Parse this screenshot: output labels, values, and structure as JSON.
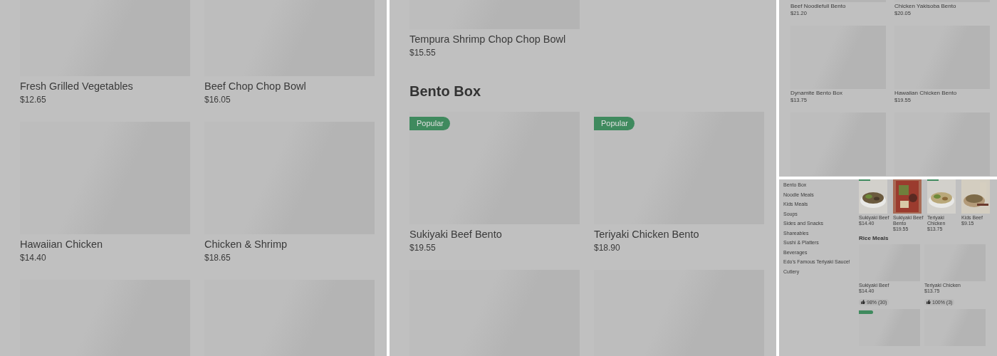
{
  "panels": [
    {
      "kind": "large",
      "sections": [
        {
          "cards": [
            {
              "kind": "item",
              "name": "Fresh Grilled Vegetables",
              "price": "$12.65"
            },
            {
              "kind": "item",
              "name": "Beef Chop Chop Bowl",
              "price": "$16.05"
            },
            {
              "kind": "item",
              "name": "Hawaiian Chicken",
              "price": "$14.40"
            },
            {
              "kind": "item",
              "name": "Chicken & Shrimp",
              "price": "$18.65"
            },
            {
              "kind": "image_only"
            },
            {
              "kind": "image_only"
            }
          ]
        }
      ]
    },
    {
      "kind": "large",
      "sections": [
        {
          "cards": [
            {
              "kind": "item",
              "name": "Tempura Shrimp Chop Chop Bowl",
              "price": "$15.55"
            }
          ]
        },
        {
          "title": "Bento Box",
          "cards": [
            {
              "kind": "item",
              "name": "Sukiyaki Beef Bento",
              "price": "$19.55",
              "badge": "Popular"
            },
            {
              "kind": "item",
              "name": "Teriyaki Chicken Bento",
              "price": "$18.90",
              "badge": "Popular"
            },
            {
              "kind": "image_only"
            },
            {
              "kind": "image_only"
            }
          ]
        }
      ]
    },
    {
      "kind": "compact",
      "sections": [
        {
          "cards": [
            {
              "kind": "item",
              "name": "Beef Noodlefull Bento",
              "price": "$21.20"
            },
            {
              "kind": "item",
              "name": "Chicken Yakisoba Bento",
              "price": "$20.05"
            },
            {
              "kind": "item",
              "name": "Dynamite Bento Box",
              "price": "$13.75"
            },
            {
              "kind": "item",
              "name": "Hawaiian Chicken Bento",
              "price": "$19.55"
            },
            {
              "kind": "image_only"
            },
            {
              "kind": "image_only"
            }
          ]
        }
      ]
    },
    {
      "kind": "store",
      "categories": [
        "Bento Box",
        "Noodle Meals",
        "Kids Meals",
        "Soups",
        "Sides and Snacks",
        "Shareables",
        "Sushi & Platters",
        "Beverages",
        "Edo's Famous Teriyaki Sauce!",
        "Cutlery"
      ],
      "featured": [
        {
          "name": "Sukiyaki Beef",
          "price": "$14.40",
          "popular": true
        },
        {
          "name": "Sukiyaki Beef Bento",
          "price": "$19.55"
        },
        {
          "name": "Teriyaki Chicken",
          "price": "$13.75",
          "popular": true
        },
        {
          "name": "Kids Beef",
          "price": "$9.15"
        }
      ],
      "section_title": "Rice Meals",
      "cards": [
        {
          "kind": "item",
          "name": "Sukiyaki Beef",
          "price": "$14.40",
          "rating": "98% (30)"
        },
        {
          "kind": "item",
          "name": "Teriyaki Chicken",
          "price": "$13.75",
          "rating": "100% (3)"
        },
        {
          "kind": "image_only",
          "popular": true
        },
        {
          "kind": "image_only"
        }
      ]
    }
  ]
}
